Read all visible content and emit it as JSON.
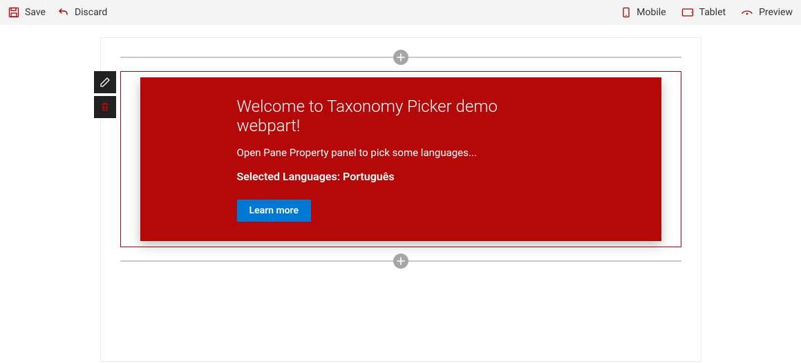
{
  "commandbar": {
    "left": {
      "save": "Save",
      "discard": "Discard"
    },
    "right": {
      "mobile": "Mobile",
      "tablet": "Tablet",
      "preview": "Preview"
    }
  },
  "webpart": {
    "title": "Welcome to Taxonomy Picker demo webpart!",
    "subtitle": "Open Pane Property panel to pick some languages...",
    "selected_label": "Selected Languages: Português",
    "learn_more": "Learn more"
  },
  "colors": {
    "accent": "#b50909",
    "primary_button": "#0078d4",
    "toolbar_bg": "#212121"
  }
}
